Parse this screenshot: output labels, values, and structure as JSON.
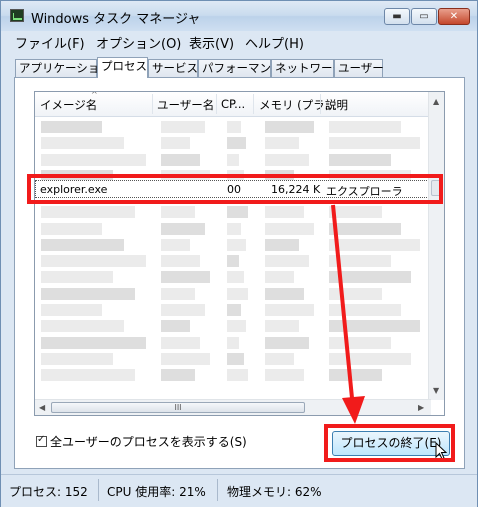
{
  "window": {
    "title": "Windows タスク マネージャ"
  },
  "title_buttons": {
    "minimize": "▬",
    "maximize": "▭",
    "close": "✕"
  },
  "menu": [
    "ファイル(F)",
    "オプション(O)",
    "表示(V)",
    "ヘルプ(H)"
  ],
  "tabs": [
    "アプリケーション",
    "プロセス",
    "サービス",
    "パフォーマンス",
    "ネットワーク",
    "ユーザー"
  ],
  "active_tab": "プロセス",
  "columns": [
    "イメージ名",
    "ユーザー名",
    "CP...",
    "メモリ (プラ...",
    "説明"
  ],
  "selected_row": {
    "image_name": "explorer.exe",
    "cpu": "00",
    "memory": "16,224 K",
    "description": "エクスプローラ"
  },
  "scroll": {
    "thumb_grip": "III"
  },
  "show_all_users": {
    "label": "全ユーザーのプロセスを表示する(S)",
    "checked": true
  },
  "end_process_button": "プロセスの終了(E)",
  "status": {
    "processes": "プロセス: 152",
    "cpu": "CPU 使用率: 21%",
    "memory": "物理メモリ: 62%"
  },
  "colors": {
    "highlight": "#f11b1b",
    "titlebar": "#c9dbee"
  }
}
